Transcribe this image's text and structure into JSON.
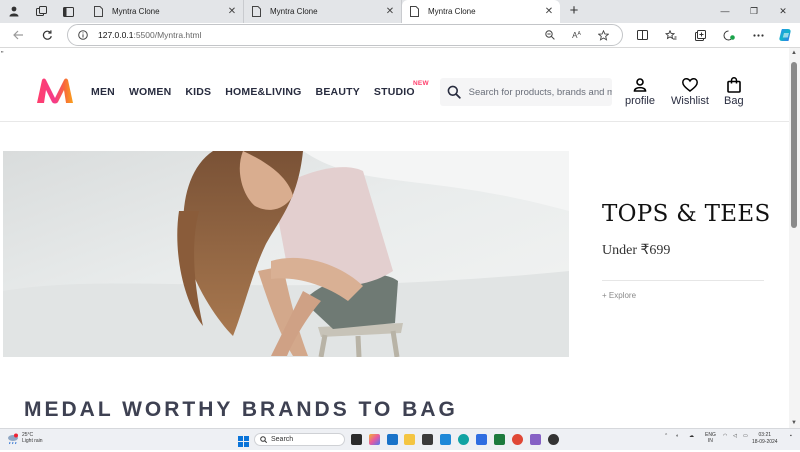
{
  "browser": {
    "tabs": [
      {
        "title": "Myntra Clone",
        "active": false
      },
      {
        "title": "Myntra Clone",
        "active": false
      },
      {
        "title": "Myntra Clone",
        "active": true
      }
    ],
    "address": {
      "host": "127.0.0.1",
      "path": ":5500/Myntra.html"
    }
  },
  "page": {
    "stray_mark": "\"",
    "nav": {
      "items": [
        "MEN",
        "WOMEN",
        "KIDS",
        "HOME&LIVING",
        "BEAUTY",
        "STUDIO"
      ],
      "studio_badge": "NEW"
    },
    "search": {
      "placeholder": "Search for products, brands and more"
    },
    "actions": {
      "profile": "profile",
      "wishlist": "Wishlist",
      "bag": "Bag"
    },
    "promo": {
      "title": "TOPS & TEES",
      "subtitle": "Under ₹699",
      "link": "+ Explore"
    },
    "section_title": "MEDAL WORTHY BRANDS TO BAG"
  },
  "taskbar": {
    "weather_temp": "25°C",
    "weather_desc": "Light rain",
    "search_label": "Search",
    "lang_1": "ENG",
    "lang_2": "IN",
    "time": "03:21",
    "date": "18-09-2024"
  },
  "colors": {
    "brand_pink": "#ff3f6c",
    "brand_orange": "#f26a10",
    "nav_text": "#282c3f",
    "section_text": "#3e4152"
  }
}
